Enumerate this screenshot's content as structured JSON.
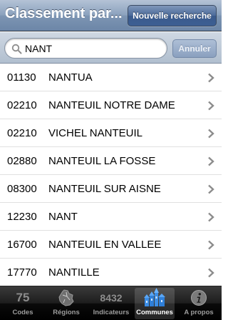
{
  "navbar": {
    "title": "Classement par...",
    "new_search_label": "Nouvelle recherche"
  },
  "search": {
    "value": "NANT",
    "cancel_label": "Annuler"
  },
  "rows": [
    {
      "code": "01130",
      "name": "NANTUA"
    },
    {
      "code": "02210",
      "name": "NANTEUIL NOTRE DAME"
    },
    {
      "code": "02210",
      "name": "VICHEL NANTEUIL"
    },
    {
      "code": "02880",
      "name": "NANTEUIL LA FOSSE"
    },
    {
      "code": "08300",
      "name": "NANTEUIL SUR AISNE"
    },
    {
      "code": "12230",
      "name": "NANT"
    },
    {
      "code": "16700",
      "name": "NANTEUIL EN VALLEE"
    },
    {
      "code": "17770",
      "name": "NANTILLE"
    }
  ],
  "tabbar": {
    "tabs": [
      {
        "number": "75",
        "label": "Codes",
        "icon": "number-badge"
      },
      {
        "number": "",
        "label": "Régions",
        "icon": "map-icon"
      },
      {
        "number": "8432",
        "label": "Indicateurs",
        "icon": "number-badge"
      },
      {
        "number": "",
        "label": "Communes",
        "icon": "town-icon"
      },
      {
        "number": "",
        "label": "A propos",
        "icon": "info-icon"
      }
    ],
    "selected": "Communes"
  },
  "colors": {
    "navbar": "#7d95b3",
    "tab_selected_icon": "#3b8de6",
    "chevron": "#8c8c8c"
  }
}
